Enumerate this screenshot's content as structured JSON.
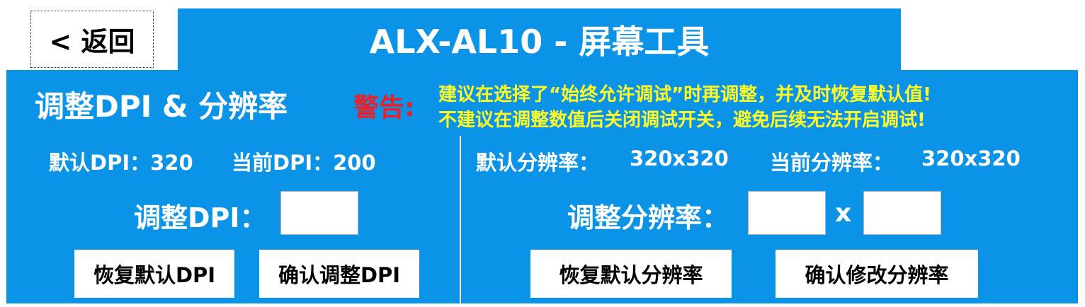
{
  "header": {
    "back_label": "< 返回",
    "title": "ALX-AL10 - 屏幕工具"
  },
  "panel": {
    "heading": "调整DPI & 分辨率",
    "warning_label": "警告:",
    "warning_lines": [
      "建议在选择了“始终允许调试”时再调整，并及时恢复默认值!",
      "不建议在调整数值后关闭调试开关，避免后续无法开启调试!"
    ]
  },
  "dpi": {
    "default_label": "默认DPI：320",
    "current_label": "当前DPI：200",
    "adjust_label": "调整DPI：",
    "input_value": "",
    "restore_button": "恢复默认DPI",
    "confirm_button": "确认调整DPI"
  },
  "resolution": {
    "default_label": "默认分辨率：",
    "default_value": "320x320",
    "current_label": "当前分辨率：",
    "current_value": "320x320",
    "adjust_label": "调整分辨率：",
    "separator": "x",
    "width_value": "",
    "height_value": "",
    "restore_button": "恢复默认分辨率",
    "confirm_button": "确认修改分辨率"
  },
  "colors": {
    "accent_blue": "#0a93e7",
    "warning_red": "#e8202a",
    "warning_yellow": "#ffff26"
  }
}
